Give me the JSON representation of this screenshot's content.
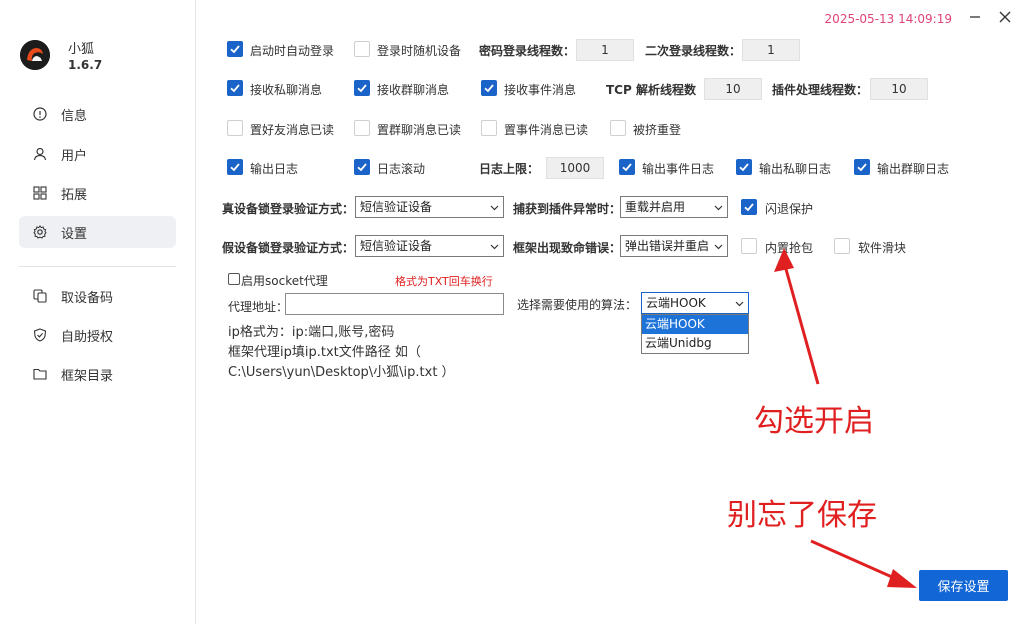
{
  "app": {
    "name": "小狐",
    "version": "1.6.7"
  },
  "header": {
    "timestamp": "2025-05-13 14:09:19"
  },
  "sidebar": {
    "items": [
      {
        "label": "信息",
        "icon": "info-icon"
      },
      {
        "label": "用户",
        "icon": "user-icon"
      },
      {
        "label": "拓展",
        "icon": "extensions-icon"
      },
      {
        "label": "设置",
        "icon": "gear-icon",
        "active": true
      },
      {
        "label": "取设备码",
        "icon": "copy-icon"
      },
      {
        "label": "自助授权",
        "icon": "shield-icon"
      },
      {
        "label": "框架目录",
        "icon": "folder-icon"
      }
    ]
  },
  "settings": {
    "row1": {
      "auto_login": {
        "label": "启动时自动登录",
        "checked": true
      },
      "random_device": {
        "label": "登录时随机设备",
        "checked": false
      },
      "pwd_threads_label": "密码登录线程数：",
      "pwd_threads_value": "1",
      "second_threads_label": "二次登录线程数：",
      "second_threads_value": "1"
    },
    "row2": {
      "private_msg": {
        "label": "接收私聊消息",
        "checked": true
      },
      "group_msg": {
        "label": "接收群聊消息",
        "checked": true
      },
      "event_msg": {
        "label": "接收事件消息",
        "checked": true
      },
      "tcp_threads_label": "TCP 解析线程数",
      "tcp_threads_value": "10",
      "plugin_threads_label": "插件处理线程数：",
      "plugin_threads_value": "10"
    },
    "row3": {
      "friend_read": {
        "label": "置好友消息已读",
        "checked": false
      },
      "group_read": {
        "label": "置群聊消息已读",
        "checked": false
      },
      "event_read": {
        "label": "置事件消息已读",
        "checked": false
      },
      "kicked_relogin": {
        "label": "被挤重登",
        "checked": false
      }
    },
    "row4": {
      "output_log": {
        "label": "输出日志",
        "checked": true
      },
      "log_scroll": {
        "label": "日志滚动",
        "checked": true
      },
      "log_limit_label": "日志上限：",
      "log_limit_value": "1000",
      "output_event_log": {
        "label": "输出事件日志",
        "checked": true
      },
      "output_private_log": {
        "label": "输出私聊日志",
        "checked": true
      },
      "output_group_log": {
        "label": "输出群聊日志",
        "checked": true
      }
    },
    "row5": {
      "real_device_label": "真设备锁登录验证方式：",
      "real_device_value": "短信验证设备",
      "plugin_exception_label": "捕获到插件异常时：",
      "plugin_exception_value": "重载并启用",
      "crash_protect": {
        "label": "闪退保护",
        "checked": true
      }
    },
    "row6": {
      "fake_device_label": "假设备锁登录验证方式：",
      "fake_device_value": "短信验证设备",
      "fatal_error_label": "框架出现致命错误：",
      "fatal_error_value": "弹出错误并重启",
      "builtin_grab": {
        "label": "内置抢包",
        "checked": false
      },
      "soft_slider": {
        "label": "软件滑块",
        "checked": false
      }
    },
    "proxy": {
      "enable": {
        "label": "启用socket代理",
        "checked": false
      },
      "format_hint": "格式为TXT回车换行",
      "address_label": "代理地址：",
      "address_value": "",
      "algo_label": "选择需要使用的算法：",
      "algo_value": "云端HOOK",
      "algo_options": [
        "云端HOOK",
        "云端Unidbg"
      ],
      "help_line1": "ip格式为：ip:端口,账号,密码",
      "help_line2": "框架代理ip填ip.txt文件路径 如（",
      "help_line3": "C:\\Users\\yun\\Desktop\\小狐\\ip.txt ）"
    },
    "save_label": "保存设置"
  },
  "annotations": {
    "check_enable": "勾选开启",
    "remember_save": "别忘了保存"
  },
  "colors": {
    "accent": "#1a64c9",
    "timestamp": "#e0427a",
    "annotation": "#e02020"
  }
}
